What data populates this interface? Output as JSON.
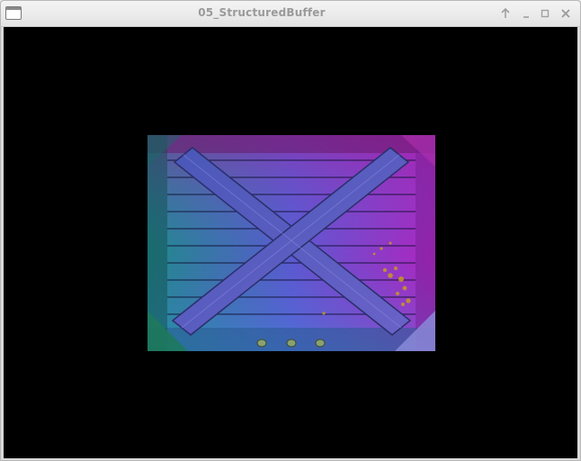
{
  "window": {
    "title": "05_StructuredBuffer",
    "icons": {
      "app": "window-icon",
      "pin": "arrow-up-icon",
      "minimize": "minimize-icon",
      "maximize": "maximize-icon",
      "close": "close-icon"
    }
  },
  "render": {
    "background_color": "#000000",
    "texture": "wooden-crate-texture",
    "gradient_colors": {
      "top_left": "#8a1a8a",
      "top_right": "#b020b8",
      "bottom_left": "#1f8a6a",
      "bottom_right": "#7a7ad8"
    }
  }
}
